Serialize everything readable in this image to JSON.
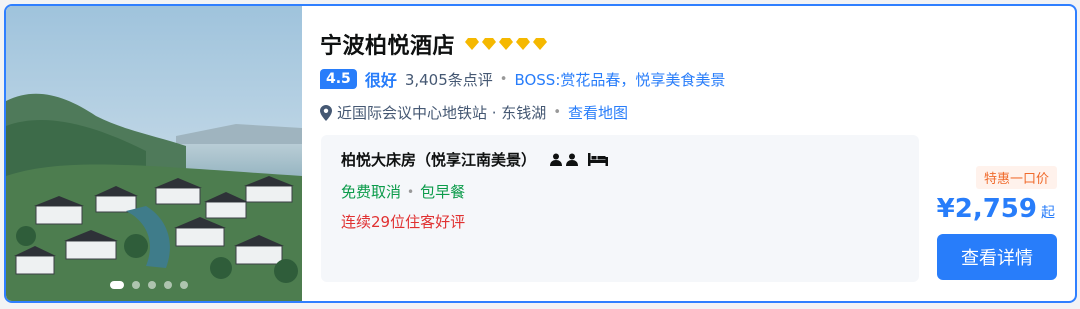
{
  "hotel": {
    "name": "宁波柏悦酒店",
    "diamond_count": 5,
    "score": "4.5",
    "rating_word": "很好",
    "review_count": "3,405条点评",
    "boss_text": "BOSS:赏花品春，悦享美食美景",
    "location_text": "近国际会议中心地铁站 · 东钱湖",
    "map_link": "查看地图"
  },
  "room": {
    "name": "柏悦大床房（悦享江南美景）",
    "perks": [
      "免费取消",
      "包早餐"
    ],
    "highlight": "连续29位住客好评"
  },
  "price": {
    "tag": "特惠一口价",
    "amount": "¥2,759",
    "suffix": "起",
    "button_label": "查看详情"
  },
  "gallery": {
    "slide_count": 5,
    "active_index": 0
  },
  "colors": {
    "accent": "#287dfa",
    "card_border": "#2f7fff",
    "diamond": "#f5b800",
    "deal": "#f06b2c",
    "highlight_red": "#e03131"
  }
}
